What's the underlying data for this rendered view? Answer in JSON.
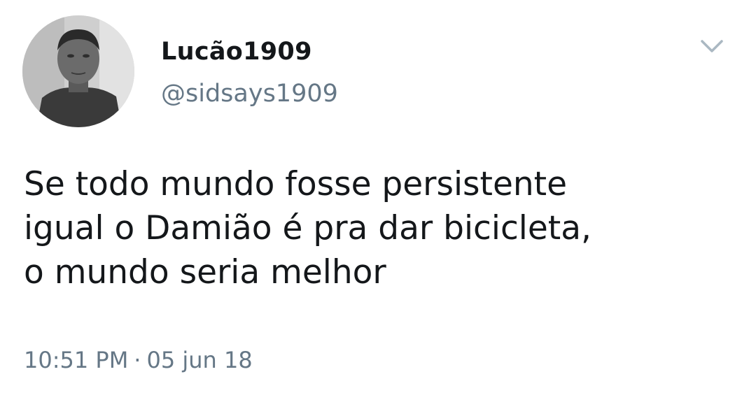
{
  "user": {
    "display_name": "Lucão1909",
    "handle": "@sidsays1909"
  },
  "tweet": {
    "text_lines": [
      "Se todo mundo fosse persistente",
      "igual o Damião é pra dar bicicleta,",
      "o mundo seria melhor"
    ],
    "time": "10:51 PM",
    "separator": "·",
    "date": "05 jun 18"
  },
  "icons": {
    "menu": "chevron-down-icon",
    "avatar": "user-avatar-photo"
  },
  "colors": {
    "name": "#14171a",
    "secondary": "#657786",
    "background": "#ffffff",
    "chevron": "#aab8c2"
  }
}
